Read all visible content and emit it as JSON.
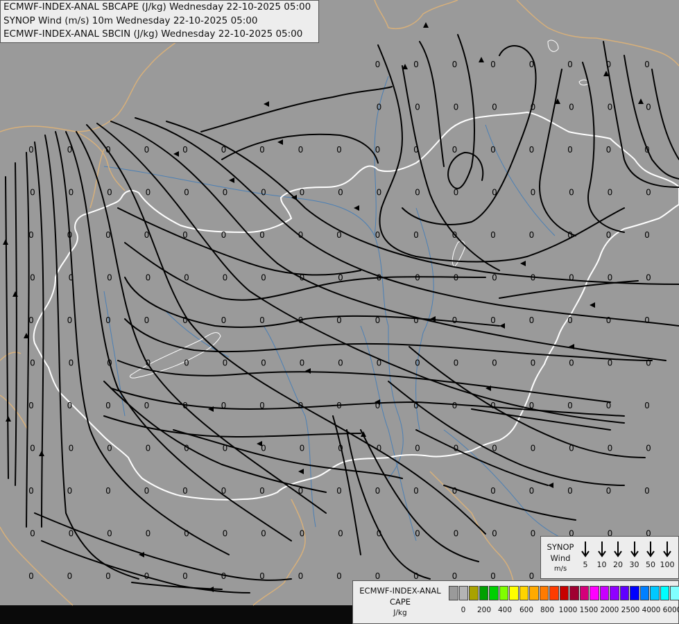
{
  "titles": {
    "line1": "ECMWF-INDEX-ANAL SBCAPE (J/kg) Wednesday 22-10-2025 05:00",
    "line2": "SYNOP Wind (m/s) 10m Wednesday 22-10-2025 05:00",
    "line3": "ECMWF-INDEX-ANAL SBCIN (J/kg) Wednesday 22-10-2025 05:00"
  },
  "map": {
    "background_color": "#9a9a9a",
    "streamline_color": "#000000",
    "value_label_color": "#000000",
    "country_border_color": "#d8b07a",
    "hungary_border_color": "#ffffff",
    "river_color": "#4a7fb5",
    "grid_value_label": "0",
    "value_grid": {
      "columns": 18,
      "rows": 13,
      "missing_cells": [
        [
          0,
          0
        ],
        [
          1,
          0
        ],
        [
          2,
          0
        ],
        [
          3,
          0
        ],
        [
          4,
          0
        ],
        [
          5,
          0
        ],
        [
          6,
          0
        ],
        [
          7,
          0
        ],
        [
          8,
          0
        ],
        [
          0,
          1
        ],
        [
          1,
          1
        ],
        [
          2,
          1
        ],
        [
          3,
          1
        ],
        [
          4,
          1
        ],
        [
          5,
          1
        ],
        [
          6,
          1
        ],
        [
          7,
          1
        ],
        [
          8,
          1
        ]
      ]
    }
  },
  "wind_legend": {
    "title": "SYNOP",
    "title2": "Wind",
    "unit": "m/s",
    "values": [
      "5",
      "10",
      "20",
      "30",
      "50",
      "100"
    ]
  },
  "cape_legend": {
    "title": "ECMWF-INDEX-ANAL",
    "title2": "CAPE",
    "unit": "J/kg",
    "colors": [
      "#9a9a9a",
      "#b4b4b4",
      "#a9a200",
      "#00a000",
      "#00d000",
      "#80ff00",
      "#ffff00",
      "#ffd400",
      "#ffaa00",
      "#ff7b00",
      "#ff3c00",
      "#c80000",
      "#a00032",
      "#d4007a",
      "#ff00ff",
      "#c800ff",
      "#9000ff",
      "#6000ff",
      "#0000ff",
      "#0080ff",
      "#00c8ff",
      "#00ffff",
      "#80ffff",
      "#ffffff"
    ],
    "tick_labels": [
      "0",
      "200",
      "400",
      "600",
      "800",
      "1000",
      "1500",
      "2000",
      "2500",
      "4000",
      "6000"
    ]
  }
}
